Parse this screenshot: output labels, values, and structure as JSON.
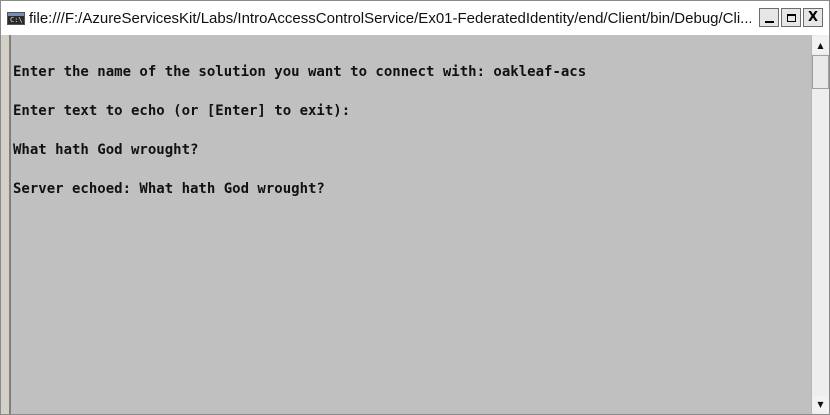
{
  "window": {
    "title": "file:///F:/AzureServicesKit/Labs/IntroAccessControlService/Ex01-FederatedIdentity/end/Client/bin/Debug/Cli...",
    "icon_text": "C:\\",
    "controls": {
      "minimize_icon": "minimize-icon",
      "maximize_icon": "maximize-icon",
      "close_label": "X"
    }
  },
  "console": {
    "background": "#c0c0c0",
    "text_color": "#111111",
    "lines": [
      "Enter the name of the solution you want to connect with: oakleaf-acs",
      "Enter text to echo (or [Enter] to exit):",
      "What hath God wrought?",
      "Server echoed: What hath God wrought?"
    ]
  },
  "scrollbar": {
    "up_arrow": "▲",
    "down_arrow": "▼"
  }
}
